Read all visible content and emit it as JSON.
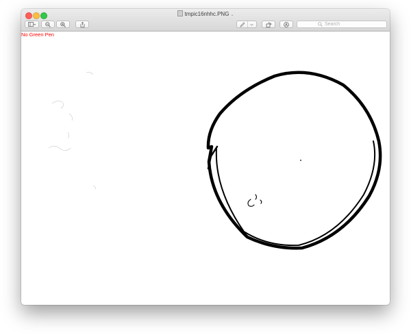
{
  "window": {
    "title": "tmpic16nhhc.PNG",
    "icons": [
      "sidebar-icon",
      "zoom-out-icon",
      "zoom-in-icon",
      "share-icon",
      "markup-pen-icon",
      "rotate-icon",
      "annotate-icon",
      "search-icon"
    ]
  },
  "toolbar": {
    "search_placeholder": "Search"
  },
  "image": {
    "label": "No Green Pen",
    "label_color": "#ff0000",
    "stroke_color": "#000000"
  }
}
